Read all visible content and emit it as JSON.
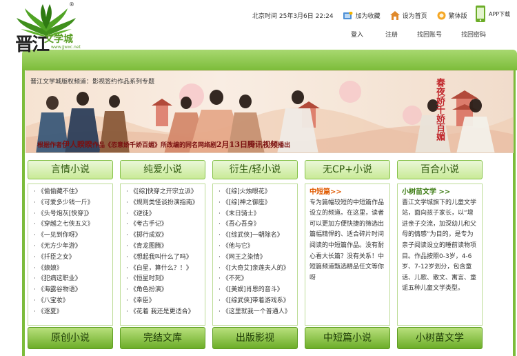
{
  "site": {
    "logo_text": "晋江",
    "logo_sub": "文学城",
    "logo_url": "www.jjwxc.net",
    "registered": "®"
  },
  "topbar": {
    "clock": "北京时间 25年3月6日 22:24",
    "add_favorite": "加为收藏",
    "set_homepage": "设为首页",
    "traditional": "繁体版",
    "app_download": "APP下载"
  },
  "userbar": {
    "login": "登入",
    "register": "注册",
    "find_account": "找回账号",
    "find_password": "找回密码"
  },
  "banner": {
    "title": "晋江文学城版权频道：影视签约作品系列专题",
    "caption_pre": "根据作者",
    "caption_author": "伊人睽睽",
    "caption_mid": "作品《恣意娇千娇百媚》所改编的同名网络剧",
    "caption_date": "2月13日腾讯视频",
    "caption_post": "播出",
    "calligraphy": "春夜娇千娇百媚"
  },
  "columns": [
    {
      "tab": "言情小说",
      "items": [
        "《偷偷藏不住》",
        "《可爱多少钱一斤》",
        "《头号炮灰[快穿]》",
        "《穿越之七侠五义》",
        "《一见到你呀》",
        "《无方少年游》",
        "《扦臣之女》",
        "《娘娘》",
        "《犯病这职业》",
        "《海露谷物语》",
        "《八宝妆》",
        "《逐夏》"
      ]
    },
    {
      "tab": "纯爱小说",
      "items": [
        "《[综]快穿之开宗立派》",
        "《规则类怪谈扮演指南》",
        "《逆徒》",
        "《考古手记》",
        "《掷行成双》",
        "《青龙图腾》",
        "《想起我叫什么了吗》",
        "《白星，算什么？！》",
        "《恒星时刻》",
        "《角色扮演》",
        "《幸臣》",
        "《花着 我还是更适合》"
      ]
    },
    {
      "tab": "衍生/轻小说",
      "items": [
        "《[综]火烛眼花》",
        "《[综]神之御座》",
        "《末日骑士》",
        "《吾心吾身》",
        "《[综武侠]一朝除名》",
        "《他与它》",
        "《网王之染情》",
        "《[大奇艾]亲莲夫人的》",
        "《不死》",
        "《[美娱]肖恩的音斗》",
        "《[综武侠]带着游戏系》",
        "《这里就我一个普通人》"
      ]
    },
    {
      "tab": "无CP+小说",
      "head": "中短篇>>",
      "text": "专为篇幅较短的中短篇作品设立的频道。在这里，读者可以更加方便快捷的筛选出篇幅精悍的、适合碎片时间阅读的中短篇作品。没有耐心看大长篇？没有关系！中短篇频道甄选精品任文等你呀"
    },
    {
      "tab": "百合小说",
      "head": "小树苗文学 >>",
      "text": "晋江文学城旗下的儿童文学站，面向孩子家长，以“增进亲子交流，加深幼儿和父母的情感”为目的，是专为亲子阅读设立的睡前读物项目。作品按照0-3岁，4-6岁、7-12岁划分，包含童话、儿歌、散文、寓言、童谣五种儿童文学类型。"
    }
  ],
  "bottom_tabs": [
    "原创小说",
    "完结文库",
    "出版影视",
    "中短篇小说",
    "小树苗文学"
  ],
  "colors": {
    "brand_green": "#7cbc3a",
    "tab_text": "#2f5a0e",
    "accent_orange": "#e05a00",
    "banner_red": "#7a1010"
  }
}
